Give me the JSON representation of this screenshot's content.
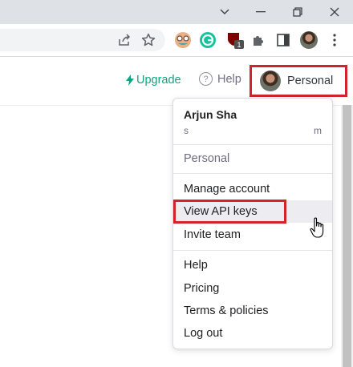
{
  "window_controls": {
    "chevron": "chevron-down-icon",
    "minimize": "minimize-icon",
    "restore": "restore-icon",
    "close": "close-icon"
  },
  "toolbar": {
    "share": "share-icon",
    "bookmark": "star-icon",
    "extensions": [
      {
        "name": "glasses-extension-icon"
      },
      {
        "name": "grammarly-extension-icon",
        "glyph": "G"
      },
      {
        "name": "ublock-extension-icon",
        "badge": "1"
      },
      {
        "name": "puzzle-extensions-icon"
      },
      {
        "name": "sidebar-icon"
      }
    ],
    "profile": "profile-avatar",
    "menu": "kebab-menu-icon"
  },
  "header": {
    "upgrade_label": "Upgrade",
    "help_label": "Help",
    "personal_label": "Personal"
  },
  "menu": {
    "user_name": "Arjun Sha",
    "email_start": "s",
    "email_end": "m",
    "org_label": "Personal",
    "items": [
      {
        "label": "Manage account"
      },
      {
        "label": "View API keys"
      },
      {
        "label": "Invite team"
      },
      {
        "label": "Help"
      },
      {
        "label": "Pricing"
      },
      {
        "label": "Terms & policies"
      },
      {
        "label": "Log out"
      }
    ]
  },
  "colors": {
    "accent": "#10a37f",
    "highlight": "#d0232c",
    "hover_bg": "#ececf1"
  }
}
